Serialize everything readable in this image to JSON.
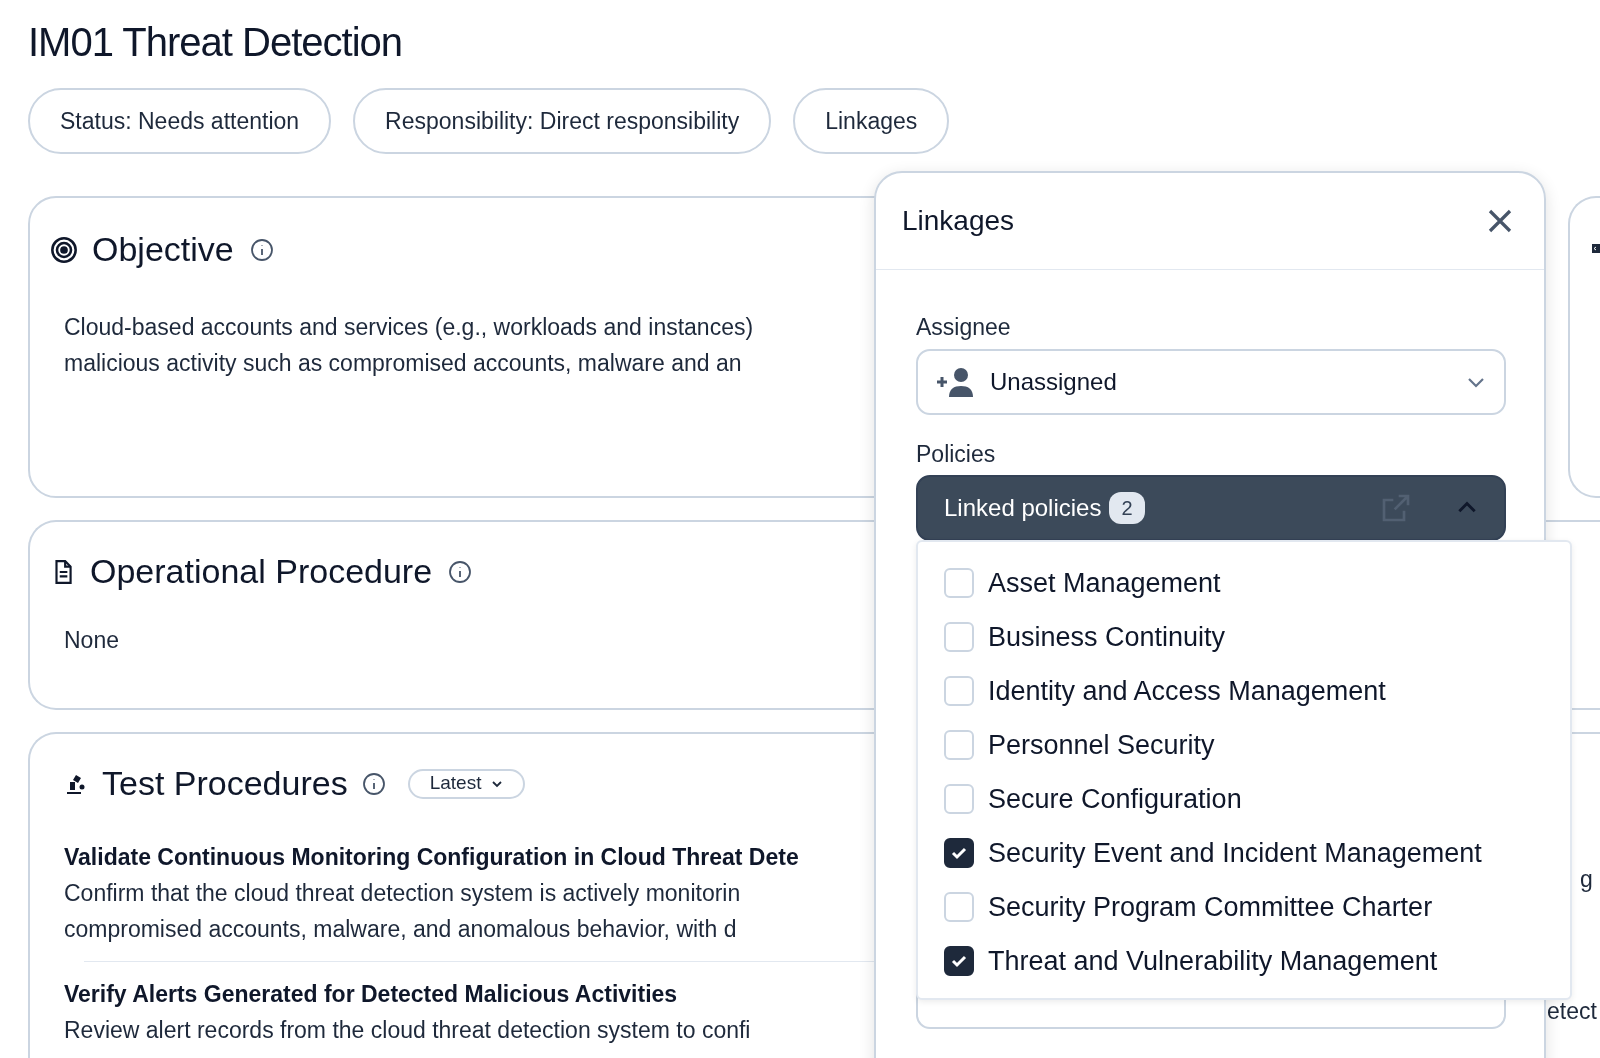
{
  "title": "IM01 Threat Detection",
  "chips": [
    "Status: Needs attention",
    "Responsibility: Direct responsibility",
    "Linkages"
  ],
  "objective": {
    "title": "Objective",
    "lines": [
      "Cloud-based accounts and services (e.g., workloads and instances)",
      "malicious activity such as compromised accounts, malware and an"
    ]
  },
  "operational_procedure": {
    "title": "Operational Procedure",
    "body": "None"
  },
  "test_procedures": {
    "title": "Test Procedures",
    "version_menu": "Latest",
    "items": [
      {
        "title": "Validate Continuous Monitoring Configuration in Cloud Threat Dete",
        "lines": [
          "Confirm that the cloud threat detection system is actively monitorin",
          "compromised accounts, malware, and anomalous behavior, with d"
        ]
      },
      {
        "title": "Verify Alerts Generated for Detected Malicious Activities",
        "lines": [
          "Review alert records from the cloud threat detection system to confi"
        ]
      }
    ],
    "right_fragments": [
      "g",
      "etect"
    ]
  },
  "linkages_panel": {
    "title": "Linkages",
    "assignee_label": "Assignee",
    "assignee": "Unassigned",
    "policies_label": "Policies",
    "policies_button": "Linked policies",
    "policies_count": "2",
    "expanded": true,
    "policies": [
      {
        "label": "Asset Management",
        "checked": false
      },
      {
        "label": "Business Continuity",
        "checked": false
      },
      {
        "label": "Identity and Access Management",
        "checked": false
      },
      {
        "label": "Personnel Security",
        "checked": false
      },
      {
        "label": "Secure Configuration",
        "checked": false
      },
      {
        "label": "Security Event and Incident Management",
        "checked": true
      },
      {
        "label": "Security Program Committee Charter",
        "checked": false
      },
      {
        "label": "Threat and Vulnerability Management",
        "checked": true
      }
    ]
  }
}
